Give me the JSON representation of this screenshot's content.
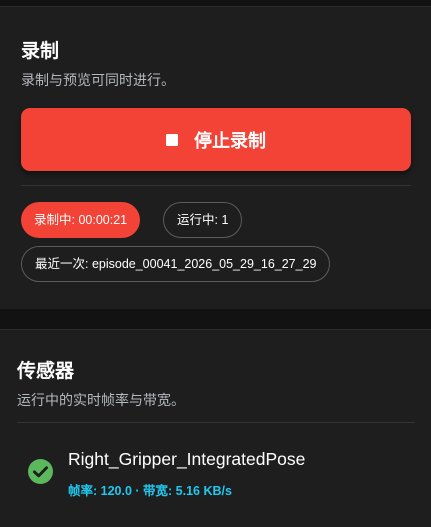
{
  "record_card": {
    "title": "录制",
    "subtitle": "录制与预览可同时进行。",
    "stop_button_label": "停止录制",
    "chips": {
      "recording": "录制中: 00:00:21",
      "running": "运行中: 1",
      "last": "最近一次: episode_00041_2026_05_29_16_27_29"
    }
  },
  "sensor_card": {
    "title": "传感器",
    "subtitle": "运行中的实时帧率与带宽。",
    "sensors": [
      {
        "name": "Right_Gripper_IntegratedPose",
        "stats": "帧率: 120.0 · 带宽: 5.16 KB/s",
        "status": "ok",
        "status_icon": "check-circle-icon"
      }
    ]
  },
  "colors": {
    "accent_red": "#f34236",
    "stats_cyan": "#20c9ef",
    "ok_green": "#5cb85c",
    "card_bg": "#1e1e1e",
    "page_bg": "#121212"
  }
}
